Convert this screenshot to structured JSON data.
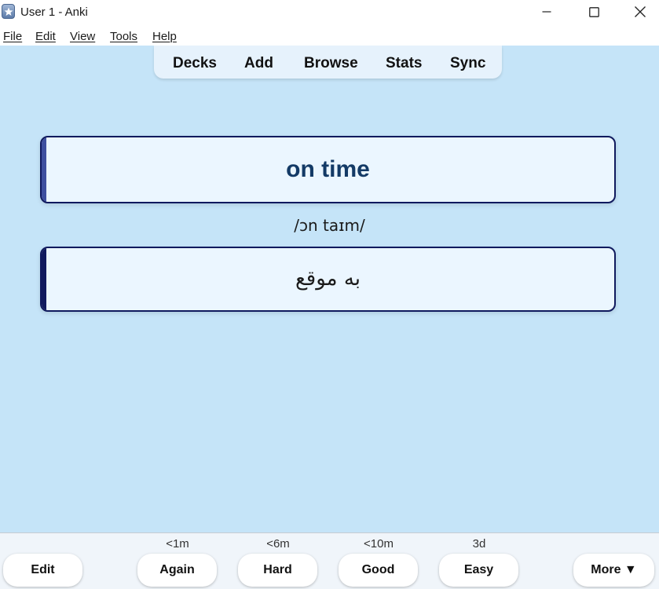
{
  "window": {
    "title": "User 1 - Anki"
  },
  "menubar": {
    "items": [
      "File",
      "Edit",
      "View",
      "Tools",
      "Help"
    ]
  },
  "toolbar": {
    "decks": "Decks",
    "add": "Add",
    "browse": "Browse",
    "stats": "Stats",
    "sync": "Sync"
  },
  "card": {
    "front": "on time",
    "pronunciation": "/ɔn taɪm/",
    "back": "به موقع"
  },
  "bottom": {
    "edit_label": "Edit",
    "more_label": "More ▼",
    "answers": [
      {
        "interval": "<1m",
        "label": "Again"
      },
      {
        "interval": "<6m",
        "label": "Hard"
      },
      {
        "interval": "<10m",
        "label": "Good"
      },
      {
        "interval": "3d",
        "label": "Easy"
      }
    ]
  },
  "colors": {
    "background": "#c5e4f8",
    "card_border": "#101a5e",
    "card_fill": "#ebf6ff",
    "front_text": "#133a66"
  }
}
